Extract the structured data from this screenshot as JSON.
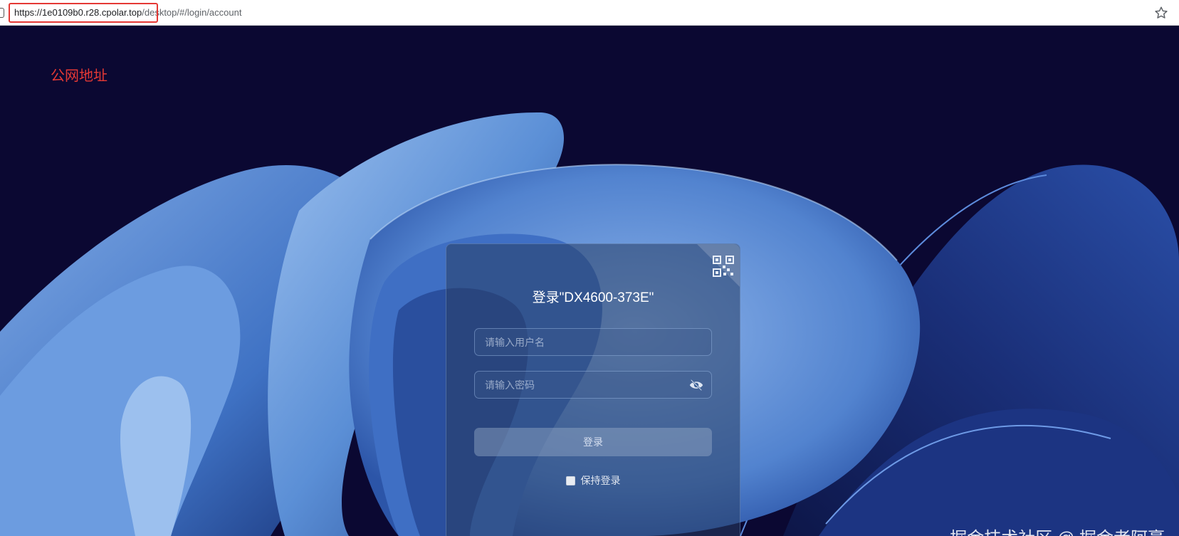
{
  "browser": {
    "url_host": "https://1e0109b0.r28.cpolar.top",
    "url_path": "/desktop/#/login/account"
  },
  "annotation": {
    "label": "公网地址",
    "color": "#e53935"
  },
  "login": {
    "title": "登录\"DX4600-373E\"",
    "username_placeholder": "请输入用户名",
    "password_placeholder": "请输入密码",
    "submit_label": "登录",
    "remember_label": "保持登录",
    "remember_checked": false
  },
  "watermark": {
    "text": "掘金技术社区 @ 掘金者阿豪"
  },
  "icons": [
    "page-info-icon",
    "bookmark-star-icon",
    "qr-code-icon",
    "eye-hidden-icon"
  ]
}
